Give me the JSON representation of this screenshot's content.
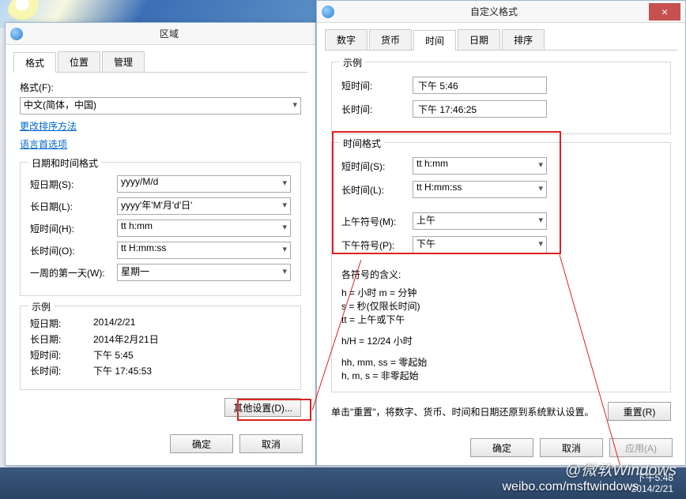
{
  "region_dialog": {
    "title": "区域",
    "tabs": [
      "格式",
      "位置",
      "管理"
    ],
    "format_label": "格式(F):",
    "format_value": "中文(简体，中国)",
    "link_sort": "更改排序方法",
    "link_lang": "语言首选项",
    "datetime_group": "日期和时间格式",
    "rows": {
      "short_date": {
        "label": "短日期(S):",
        "value": "yyyy/M/d"
      },
      "long_date": {
        "label": "长日期(L):",
        "value": "yyyy'年'M'月'd'日'"
      },
      "short_time": {
        "label": "短时间(H):",
        "value": "tt h:mm"
      },
      "long_time": {
        "label": "长时间(O):",
        "value": "tt H:mm:ss"
      },
      "first_day": {
        "label": "一周的第一天(W):",
        "value": "星期一"
      }
    },
    "example_group": "示例",
    "examples": {
      "short_date": {
        "label": "短日期:",
        "value": "2014/2/21"
      },
      "long_date": {
        "label": "长日期:",
        "value": "2014年2月21日"
      },
      "short_time": {
        "label": "短时间:",
        "value": "下午 5:45"
      },
      "long_time": {
        "label": "长时间:",
        "value": "下午 17:45:53"
      }
    },
    "other_settings": "其他设置(D)...",
    "ok": "确定",
    "cancel": "取消"
  },
  "custom_dialog": {
    "title": "自定义格式",
    "tabs": [
      "数字",
      "货币",
      "时间",
      "日期",
      "排序"
    ],
    "active_tab": 2,
    "example_group": "示例",
    "ex_short": {
      "label": "短时间:",
      "value": "下午 5:46"
    },
    "ex_long": {
      "label": "长时间:",
      "value": "下午 17:46:25"
    },
    "format_group": "时间格式",
    "fields": {
      "short_time": {
        "label": "短时间(S):",
        "value": "tt h:mm"
      },
      "long_time": {
        "label": "长时间(L):",
        "value": "tt H:mm:ss"
      },
      "am": {
        "label": "上午符号(M):",
        "value": "上午"
      },
      "pm": {
        "label": "下午符号(P):",
        "value": "下午"
      }
    },
    "legend_title": "各符号的含义:",
    "legend_l1": "h = 小时   m = 分钟",
    "legend_l2": "s = 秒(仅限长时间)",
    "legend_l3": "tt = 上午或下午",
    "legend_l4": "h/H = 12/24 小时",
    "legend_l5": "hh, mm, ss = 零起始",
    "legend_l6": "h, m, s = 非零起始",
    "reset_hint": "单击\"重置\"，将数字、货币、时间和日期还原到系统默认设置。",
    "reset": "重置(R)",
    "ok": "确定",
    "cancel": "取消",
    "apply": "应用(A)"
  },
  "taskbar": {
    "time": "下午5:48",
    "date": "2014/2/21"
  },
  "watermark_top": "@微软Windows",
  "watermark_bottom": "weibo.com/msftwindows"
}
